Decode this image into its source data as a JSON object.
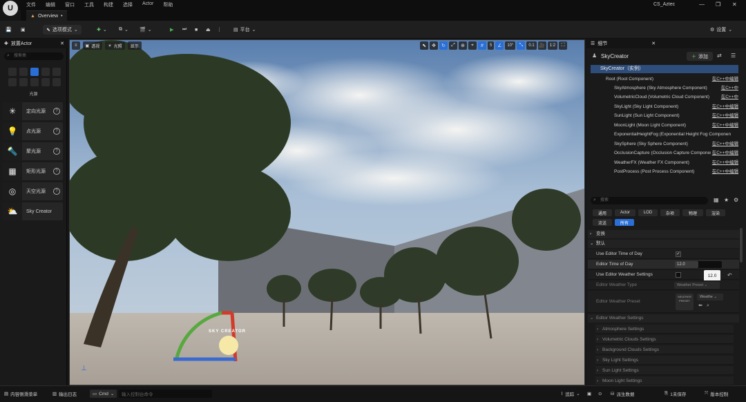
{
  "app": {
    "menu": [
      "文件",
      "编辑",
      "窗口",
      "工具",
      "构建",
      "选择",
      "Actor",
      "帮助"
    ],
    "project_name": "CS_Aztec",
    "tab_label": "Overview",
    "window_buttons": [
      "—",
      "❐",
      "✕"
    ]
  },
  "toolbar": {
    "mode_label": "选项模式",
    "platform_label": "平台",
    "settings_label": "设置"
  },
  "place_actors": {
    "panel_title": "放置Actor",
    "search_placeholder": "搜索类",
    "category_label": "光源",
    "items": [
      {
        "label": "定向光源",
        "icon": "directional-light-icon"
      },
      {
        "label": "点光源",
        "icon": "point-light-icon"
      },
      {
        "label": "聚光源",
        "icon": "spot-light-icon"
      },
      {
        "label": "矩形光源",
        "icon": "rect-light-icon"
      },
      {
        "label": "天空光源",
        "icon": "sky-light-icon"
      },
      {
        "label": "Sky Creator",
        "icon": "sky-creator-icon"
      }
    ]
  },
  "viewport": {
    "view_mode": "透视",
    "lit_mode": "光照",
    "show_label": "显示",
    "grid_snap": "5",
    "rotation_snap": "10°",
    "scale_snap": "0.1",
    "camera_speed": "1:2",
    "gizmo_label": "SKY CREATOR"
  },
  "details": {
    "panel_title": "细节",
    "actor_name": "SkyCreator",
    "add_label": "添加",
    "instance_label": "SkyCreator（实例）",
    "components": [
      {
        "label": "Root (Root Component)",
        "edit": "在C++中编辑"
      },
      {
        "label": "SkyAtmosphere (Sky Atmosphere Component)",
        "edit": "在C++中"
      },
      {
        "label": "VolumetricCloud (Volumetric Cloud Component)",
        "edit": "在C++中"
      },
      {
        "label": "SkyLight (Sky Light Component)",
        "edit": "在C++中编辑"
      },
      {
        "label": "SunLight (Sun Light Component)",
        "edit": "在C++中编辑"
      },
      {
        "label": "MoonLight (Moon Light Component)",
        "edit": "在C++中编辑"
      },
      {
        "label": "ExponentialHeightFog (Exponential Height Fog Componen",
        "edit": ""
      },
      {
        "label": "SkySphere (Sky Sphere Component)",
        "edit": "在C++中编辑"
      },
      {
        "label": "OcclusionCapture (Occlusion Capture Component)",
        "edit": "在C++中编辑"
      },
      {
        "label": "WeatherFX (Weather FX Component)",
        "edit": "在C++中编辑"
      },
      {
        "label": "PostProcess (Post Process Component)",
        "edit": "在C++中编辑"
      }
    ],
    "search_placeholder": "搜索",
    "filter_tabs_row1": [
      "通用",
      "Actor",
      "LOD",
      "杂项",
      "物理",
      "渲染"
    ],
    "filter_tabs_row2": [
      "流送",
      "所有"
    ],
    "sections": {
      "transform": "变换",
      "default": "默认"
    },
    "props": {
      "use_editor_time_of_day": "Use Editor Time of Day",
      "editor_time_of_day": "Editor Time of Day",
      "editor_time_value": "12.0",
      "editor_time_popup": "12.0",
      "use_editor_weather": "Use Editor Weather Settings",
      "editor_weather_type": "Editor Weather Type",
      "weather_preset_select": "Weather Preset",
      "editor_weather_preset": "Editor Weather Preset",
      "weather_preset_thumb": "WEATHER PRESET",
      "weathe_select": "Weathe",
      "editor_weather_settings": "Editor Weather Settings"
    },
    "subsections": [
      "Atmosphere Settings",
      "Volumetric Clouds Settings",
      "Background Clouds Settings",
      "Sky Light Settings",
      "Sun Light Settings",
      "Moon Light Settings"
    ]
  },
  "bottom": {
    "content_drawer": "内容侧滑菜单",
    "output_log": "输出日志",
    "cmd_label": "Cmd",
    "console_placeholder": "输入控制台命令",
    "trace_label": "追踪",
    "derived_data": "派生数据",
    "unsaved": "1未保存",
    "source_control": "版本控制"
  }
}
